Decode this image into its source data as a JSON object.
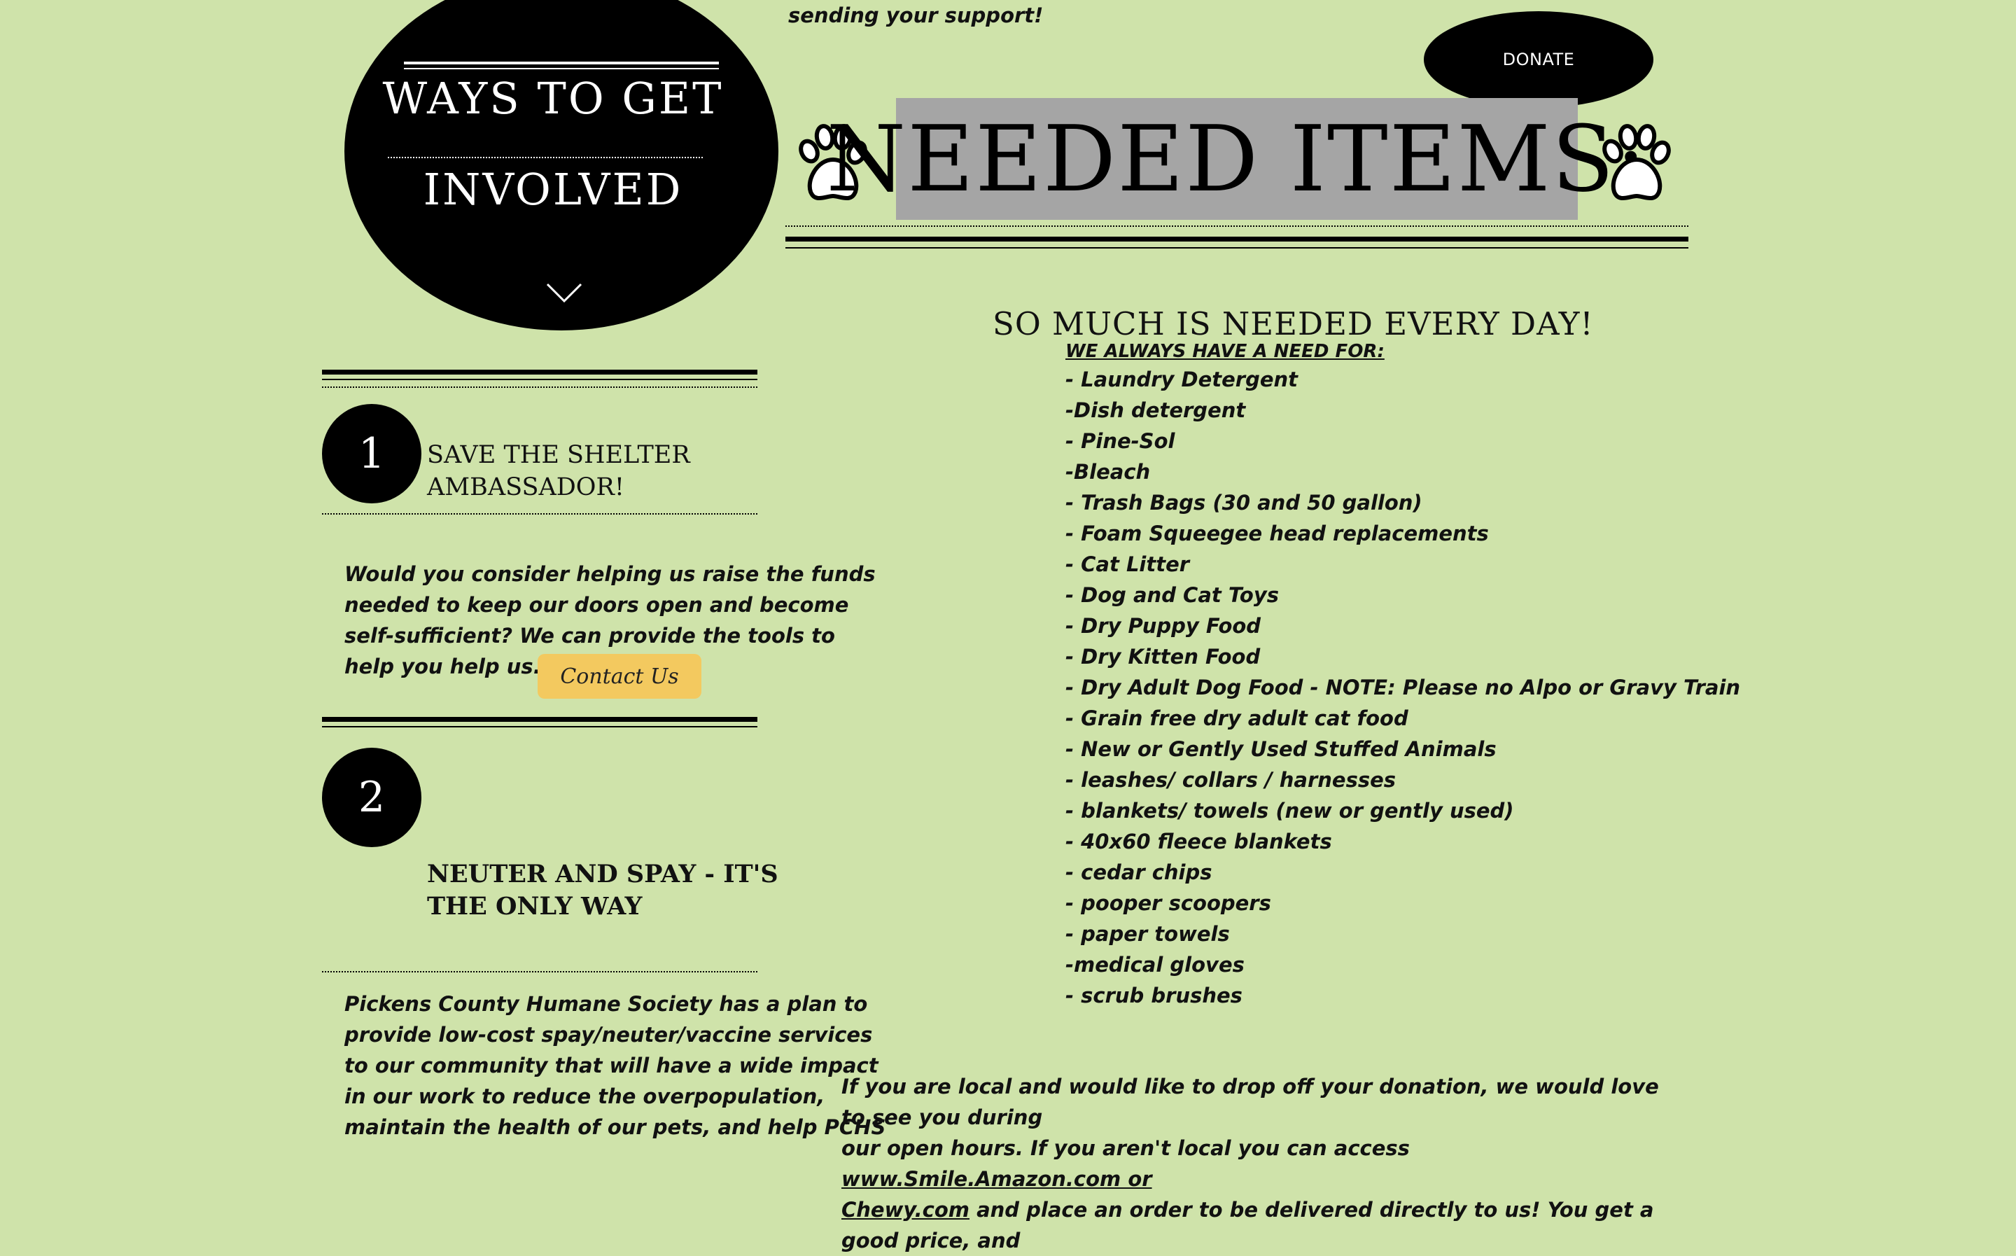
{
  "left": {
    "banner": {
      "line1": "WAYS TO GET",
      "line2": "INVOLVED",
      "chevron_icon": "chevron-down-icon"
    },
    "section1": {
      "number": "1",
      "title_line1": "SAVE THE SHELTER",
      "title_line2": "AMBASSADOR!",
      "body_lines": [
        "Would you consider helping us raise the funds",
        "needed to keep our doors open and become",
        "self-sufficient?  We can provide the tools to",
        "help you help us."
      ],
      "button_label": "Contact Us"
    },
    "section2": {
      "number": "2",
      "title_line1": "NEUTER AND SPAY - IT'S",
      "title_line2": "THE ONLY WAY",
      "body_lines": [
        "Pickens County Humane Society has a plan to",
        "provide low-cost spay/neuter/vaccine services",
        "to our community that will have a wide impact",
        "in our work to reduce the overpopulation,",
        "maintain the health of our pets, and help PCHS"
      ]
    }
  },
  "right": {
    "support_text": "sending your support!",
    "donate_label": "DONATE",
    "title": "NEEDED ITEMS:",
    "paw_icon": "paw-print-icon",
    "subtitle": "SO MUCH IS NEEDED EVERY DAY!",
    "need_heading": "WE ALWAYS HAVE A NEED FOR:",
    "needs": [
      "- Laundry Detergent",
      "-Dish detergent",
      "- Pine-Sol",
      "-Bleach",
      "- Trash Bags (30 and 50 gallon)",
      "- Foam Squeegee head replacements",
      "- Cat Litter",
      "- Dog and Cat Toys",
      "- Dry Puppy Food",
      "- Dry Kitten Food",
      "- Dry Adult Dog Food - NOTE: Please no Alpo or Gravy Train",
      "- Grain free dry adult cat food",
      "- New or Gently Used Stuffed Animals",
      "- leashes/ collars / harnesses",
      "- blankets/ towels (new or gently used)",
      "- 40x60 fleece blankets",
      "- cedar chips",
      "- pooper scoopers",
      "- paper towels",
      "-medical gloves",
      "- scrub brushes"
    ],
    "drop_off": {
      "line1": "If you are local and would like to drop off your donation, we would love to see you during",
      "line2_prefix": "our open hours. If you aren't local you can access ",
      "line2_link": "www.Smile.Amazon.com or",
      "line3_link": "Chewy.com",
      "line3_suffix": " and place an order to be delivered directly to us!  You get a good price, and"
    }
  },
  "colors": {
    "background": "#cfe3aa",
    "title_highlight": "#a5a5a5",
    "button_yellow": "#f3c95f"
  }
}
